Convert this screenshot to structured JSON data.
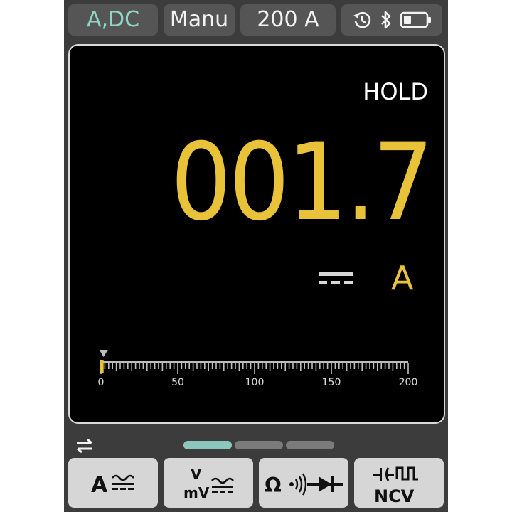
{
  "status_bar": {
    "mode": "A,DC",
    "range_mode": "Manu",
    "range": "200 A",
    "icons": [
      "auto-power-off-timer-icon",
      "bluetooth-icon",
      "battery-icon"
    ]
  },
  "display": {
    "hold_label": "HOLD",
    "reading": "001.7",
    "dc_symbol_icon": "dc-symbol-icon",
    "unit": "A"
  },
  "scale": {
    "min": 0,
    "max": 200,
    "value": 1.7,
    "tick_labels": [
      "0",
      "50",
      "100",
      "150",
      "200"
    ]
  },
  "function_panel": {
    "page_indicator": {
      "count": 3,
      "active": 0
    },
    "buttons": [
      {
        "name": "current-ac-dc-button",
        "label": "A",
        "icon": "ac-dc-icon"
      },
      {
        "name": "voltage-ac-dc-button",
        "label_top": "V",
        "label_bottom": "mV",
        "icon": "ac-dc-icon"
      },
      {
        "name": "resistance-continuity-diode-button",
        "label": "Ω",
        "icons": [
          "continuity-icon",
          "diode-icon"
        ]
      },
      {
        "name": "capacitance-frequency-ncv-button",
        "label": "NCV",
        "icons": [
          "capacitor-icon",
          "square-wave-icon"
        ]
      }
    ]
  },
  "colors": {
    "accent_teal": "#8fd6c6",
    "reading_yellow": "#e8c33a",
    "pill_bg": "#555555",
    "device_bg": "#3c3c3c"
  }
}
